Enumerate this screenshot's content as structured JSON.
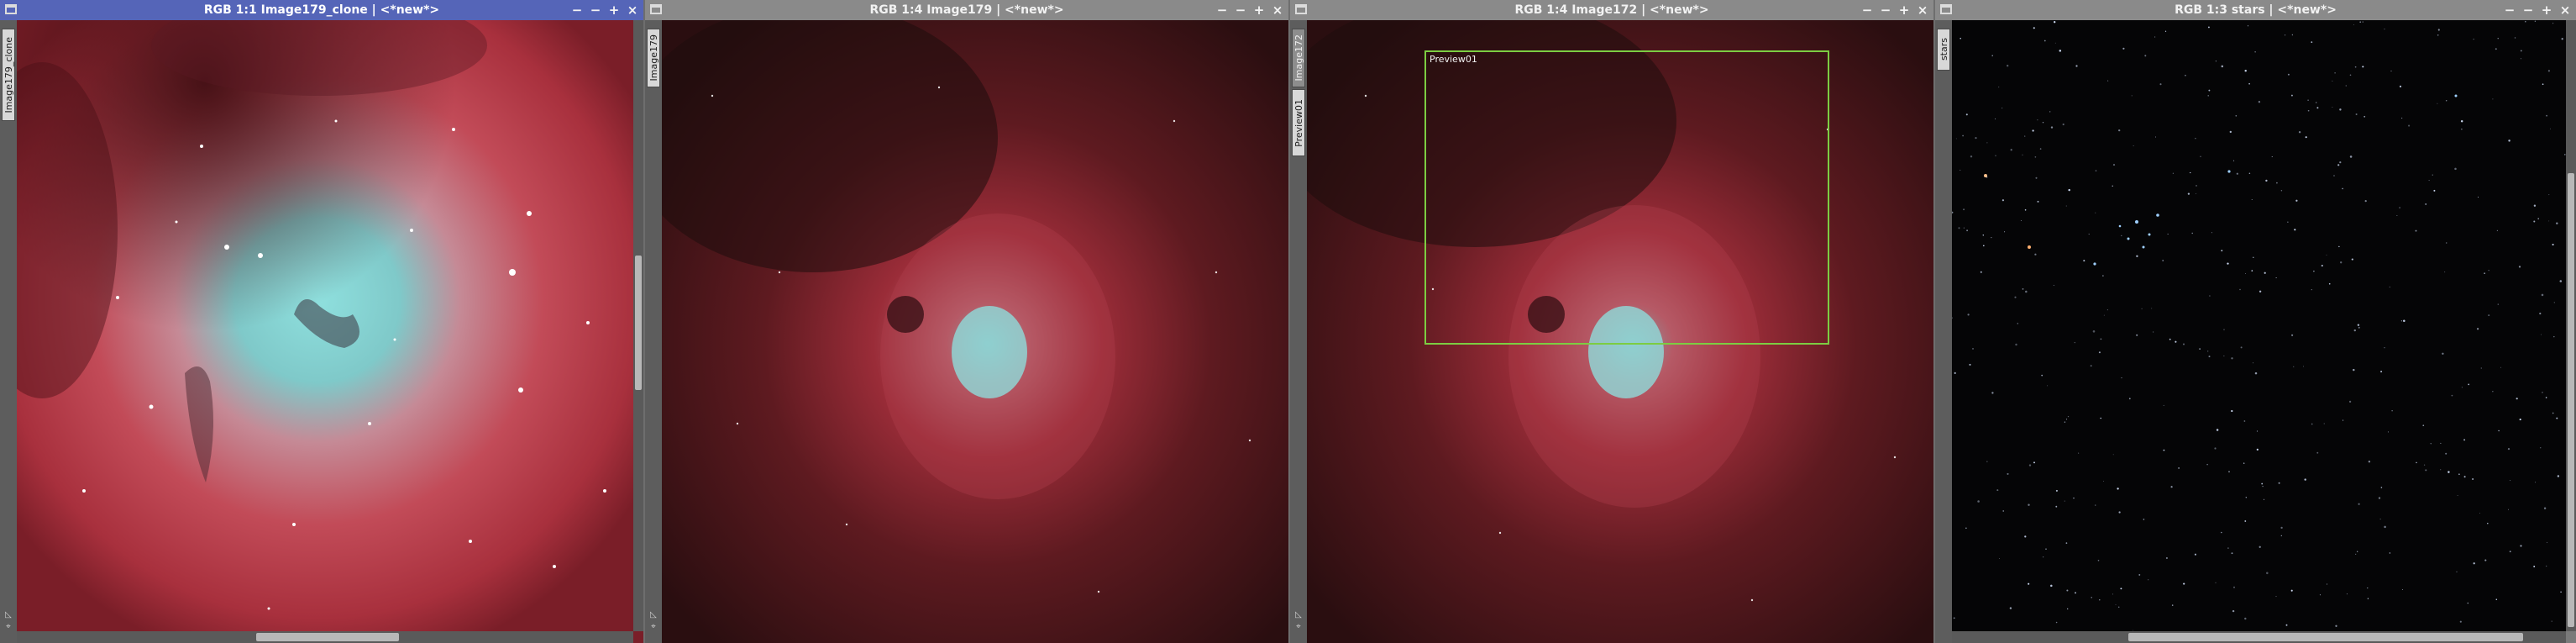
{
  "windows": [
    {
      "title": "RGB 1:1 Image179_clone | <*new*>",
      "tab": "Image179_clone",
      "active": true
    },
    {
      "title": "RGB 1:4 Image179 | <*new*>",
      "tab": "Image179",
      "active": false
    },
    {
      "title": "RGB 1:4 Image172 | <*new*>",
      "tab": "Image172",
      "tab2": "Preview01",
      "preview_label": "Preview01",
      "active": false
    },
    {
      "title": "RGB 1:3 stars | <*new*>",
      "tab": "stars",
      "active": false
    }
  ],
  "controls": {
    "minimize": "−",
    "shade": "−",
    "maximize": "+",
    "close": "×"
  },
  "colors": {
    "active_title": "#5565b8",
    "inactive_title": "#8a8a8a",
    "preview_border": "#7ccd42"
  }
}
